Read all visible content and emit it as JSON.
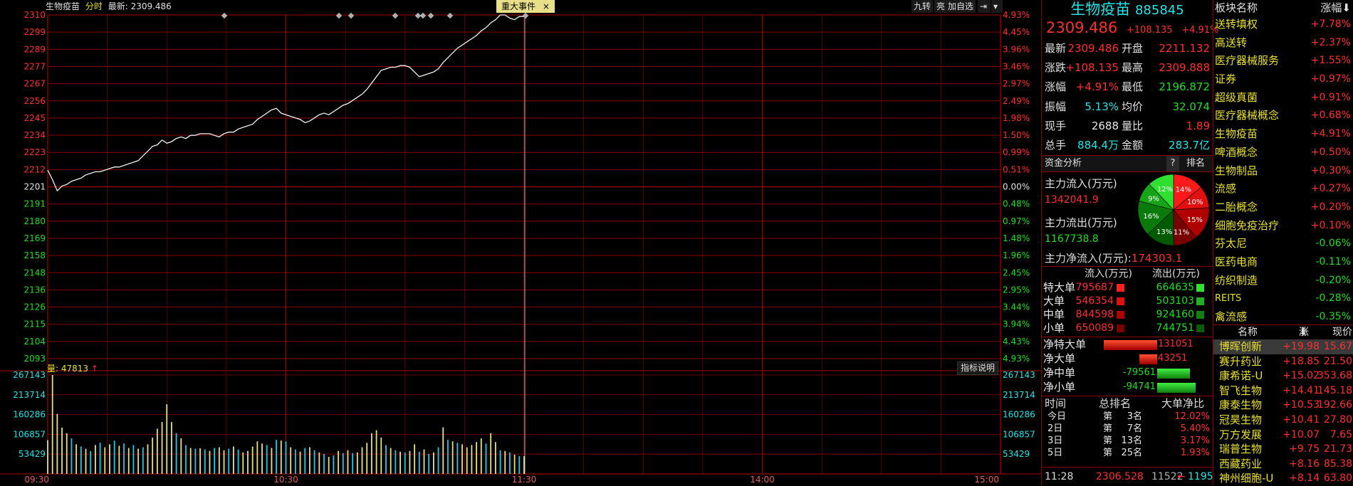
{
  "header": {
    "name": "生物疫苗",
    "mode": "分时",
    "latest_label": "最新:",
    "latest_value": "2309.486",
    "event_tab": "重大事件",
    "event_close": "×",
    "buttons": [
      "九转",
      "亮",
      "加自选"
    ]
  },
  "chart_data": {
    "type": "line",
    "y_ticks": [
      "2310",
      "2299",
      "2289",
      "2277",
      "2267",
      "2256",
      "2245",
      "2234",
      "2223",
      "2212",
      "2201",
      "2191",
      "2180",
      "2169",
      "2158",
      "2148",
      "2136",
      "2126",
      "2115",
      "2104",
      "2093"
    ],
    "pct_ticks": [
      "4.93%",
      "4.45%",
      "3.96%",
      "3.46%",
      "2.97%",
      "2.49%",
      "1.98%",
      "1.50%",
      "0.99%",
      "0.51%",
      "0.00%",
      "0.48%",
      "0.97%",
      "1.48%",
      "1.96%",
      "2.45%",
      "2.95%",
      "3.44%",
      "3.94%",
      "4.43%",
      "4.93%"
    ],
    "prev_close": 2201.351,
    "ylim": [
      2093,
      2310
    ],
    "time_ticks": [
      "09:30",
      "10:30",
      "11:30",
      "14:00",
      "15:00"
    ],
    "price_series": [
      2212,
      2206,
      2199,
      2202,
      2203,
      2205,
      2206,
      2207,
      2209,
      2210,
      2211,
      2211,
      2212,
      2213,
      2214,
      2214,
      2215,
      2216,
      2217,
      2218,
      2221,
      2224,
      2227,
      2228,
      2231,
      2229,
      2230,
      2232,
      2233,
      2232,
      2234,
      2234,
      2235,
      2235,
      2235,
      2234,
      2233,
      2235,
      2236,
      2236,
      2238,
      2239,
      2240,
      2241,
      2244,
      2246,
      2248,
      2250,
      2251,
      2248,
      2247,
      2246,
      2245,
      2244,
      2242,
      2243,
      2245,
      2247,
      2248,
      2247,
      2249,
      2251,
      2253,
      2254,
      2256,
      2258,
      2260,
      2263,
      2267,
      2271,
      2275,
      2276,
      2277,
      2277,
      2278,
      2278,
      2277,
      2274,
      2271,
      2272,
      2273,
      2274,
      2276,
      2280,
      2283,
      2286,
      2289,
      2291,
      2293,
      2295,
      2297,
      2300,
      2302,
      2305,
      2307,
      2310,
      2310,
      2308,
      2307,
      2309,
      2309
    ],
    "volume": {
      "label": "量:",
      "value": "47813",
      "y_ticks": [
        "267143",
        "213714",
        "160286",
        "106857",
        "53429"
      ],
      "ylim": [
        0,
        267143
      ],
      "bars": [
        91000,
        267143,
        162000,
        125000,
        110000,
        96000,
        80000,
        74000,
        68000,
        62000,
        78000,
        84000,
        72000,
        80000,
        90000,
        76000,
        82000,
        70000,
        78000,
        68000,
        72000,
        80000,
        98000,
        122000,
        140000,
        188000,
        140000,
        110000,
        96000,
        78000,
        70000,
        68000,
        69000,
        66000,
        62000,
        70000,
        72000,
        64000,
        68000,
        74000,
        66000,
        58000,
        62000,
        74000,
        88000,
        82000,
        78000,
        70000,
        92000,
        90000,
        88000,
        72000,
        66000,
        60000,
        70000,
        72000,
        64000,
        58000,
        54000,
        46000,
        50000,
        62000,
        56000,
        64000,
        56000,
        58000,
        72000,
        84000,
        110000,
        118000,
        98000,
        78000,
        70000,
        64000,
        60000,
        58000,
        62000,
        80000,
        60000,
        66000,
        54000,
        58000,
        72000,
        126000,
        92000,
        88000,
        84000,
        80000,
        72000,
        78000,
        86000,
        96000,
        82000,
        110000,
        86000,
        64000,
        62000,
        58000,
        52000,
        48000,
        47813
      ],
      "bar_colors_up": [
        true,
        true,
        true,
        true,
        true,
        false,
        true,
        false,
        true,
        false,
        true,
        false,
        true,
        true,
        false,
        true,
        false,
        true,
        false,
        true,
        false,
        true,
        true,
        true,
        true,
        true,
        true,
        false,
        true,
        false,
        true,
        false,
        true,
        false,
        true,
        false,
        true,
        true,
        false,
        true,
        false,
        true,
        true,
        true,
        true,
        true,
        false,
        true,
        false,
        true,
        false,
        true,
        false,
        true,
        false,
        true,
        false,
        true,
        false,
        true,
        false,
        true,
        false,
        true,
        false,
        true,
        true,
        true,
        true,
        true,
        true,
        false,
        true,
        false,
        true,
        false,
        true,
        true,
        false,
        true,
        false,
        true,
        false,
        true,
        false,
        true,
        false,
        true,
        true,
        true,
        true,
        true,
        false,
        true,
        true,
        false,
        true,
        false,
        true,
        false,
        true
      ]
    },
    "event_markers_count": 9
  },
  "indicator_button": "指标说明",
  "quote": {
    "title_name": "生物疫苗",
    "title_code": "885845",
    "price": "2309.486",
    "change": "+108.135",
    "change_pct": "+4.91%",
    "rows": [
      {
        "l1": "最新",
        "v1": "2309.486",
        "l2": "开盘",
        "v2": "2211.132",
        "c1": "red",
        "c2": "red"
      },
      {
        "l1": "涨跌",
        "v1": "+108.135",
        "l2": "最高",
        "v2": "2309.888",
        "c1": "red",
        "c2": "red"
      },
      {
        "l1": "涨幅",
        "v1": "+4.91%",
        "l2": "最低",
        "v2": "2196.872",
        "c1": "red",
        "c2": "green"
      },
      {
        "l1": "振幅",
        "v1": "5.13%",
        "l2": "均价",
        "v2": "32.074",
        "c1": "cyan",
        "c2": "green"
      },
      {
        "l1": "现手",
        "v1": "2688",
        "l2": "量比",
        "v2": "1.89",
        "c1": "white",
        "c2": "red"
      },
      {
        "l1": "总手",
        "v1": "884.4万",
        "l2": "金额",
        "v2": "283.7亿",
        "c1": "cyan",
        "c2": "cyan"
      }
    ]
  },
  "capital": {
    "header": "资金分析",
    "help": "?",
    "rank": "排名",
    "inflow_label": "主力流入(万元)",
    "inflow_value": "1342041.9",
    "outflow_label": "主力流出(万元)",
    "outflow_value": "1167738.8",
    "net_label": "主力净流入(万元):",
    "net_value": "174303.1",
    "pie": [
      {
        "label": "14%",
        "value": 14,
        "color": "#ff1a1a"
      },
      {
        "label": "10%",
        "value": 10,
        "color": "#e01010"
      },
      {
        "label": "15%",
        "value": 15,
        "color": "#b00000"
      },
      {
        "label": "11%",
        "value": 11,
        "color": "#7a0000"
      },
      {
        "label": "13%",
        "value": 13,
        "color": "#005a00"
      },
      {
        "label": "16%",
        "value": 16,
        "color": "#0a7a0a"
      },
      {
        "label": "9%",
        "value": 9,
        "color": "#16a516"
      },
      {
        "label": "12%",
        "value": 12,
        "color": "#30e030"
      }
    ],
    "flow_header_in": "流入(万元)",
    "flow_header_out": "流出(万元)",
    "flows": [
      {
        "name": "特大单",
        "in": "795687",
        "out": "664635"
      },
      {
        "name": "大单",
        "in": "546354",
        "out": "503103"
      },
      {
        "name": "中单",
        "in": "844598",
        "out": "924160"
      },
      {
        "name": "小单",
        "in": "650089",
        "out": "744751"
      }
    ],
    "nets": [
      {
        "name": "净特大单",
        "value": "131051",
        "amount": 131051
      },
      {
        "name": "净大单",
        "value": "43251",
        "amount": 43251
      },
      {
        "name": "净中单",
        "value": "-79561",
        "amount": -79561
      },
      {
        "name": "净小单",
        "value": "-94741",
        "amount": -94741
      }
    ],
    "rank_header": {
      "time": "时间",
      "rank": "总排名",
      "ratio": "大单净比"
    },
    "ranks": [
      {
        "time": "今日",
        "di": "第",
        "n": "3",
        "ming": "名",
        "ratio": "12.02%"
      },
      {
        "time": "2日",
        "di": "第",
        "n": "7",
        "ming": "名",
        "ratio": "5.40%"
      },
      {
        "time": "3日",
        "di": "第",
        "n": "13",
        "ming": "名",
        "ratio": "3.17%"
      },
      {
        "time": "5日",
        "di": "第",
        "n": "25",
        "ming": "名",
        "ratio": "1.93%"
      }
    ],
    "bottom": {
      "time": "11:28",
      "price": "2306.528",
      "vol": "11522",
      "arrow": "←",
      "count": "1195"
    }
  },
  "sectors": {
    "header_name": "板块名称",
    "header_pct": "涨幅",
    "sort_icon": "⬇",
    "rows": [
      {
        "name": "送转填权",
        "pct": "+7.78%"
      },
      {
        "name": "高送转",
        "pct": "+2.37%"
      },
      {
        "name": "医疗器械服务",
        "pct": "+1.55%"
      },
      {
        "name": "证券",
        "pct": "+0.97%"
      },
      {
        "name": "超级真菌",
        "pct": "+0.91%"
      },
      {
        "name": "医疗器械概念",
        "pct": "+0.68%"
      },
      {
        "name": "生物疫苗",
        "pct": "+4.91%"
      },
      {
        "name": "啤酒概念",
        "pct": "+0.50%"
      },
      {
        "name": "生物制品",
        "pct": "+0.30%"
      },
      {
        "name": "流感",
        "pct": "+0.27%"
      },
      {
        "name": "二胎概念",
        "pct": "+0.20%"
      },
      {
        "name": "细胞免疫治疗",
        "pct": "+0.10%"
      },
      {
        "name": "芬太尼",
        "pct": "-0.06%"
      },
      {
        "name": "医药电商",
        "pct": "-0.11%"
      },
      {
        "name": "纺织制造",
        "pct": "-0.20%"
      },
      {
        "name": "REITS",
        "pct": "-0.28%"
      },
      {
        "name": "禽流感",
        "pct": "-0.35%"
      }
    ]
  },
  "stocks": {
    "header_name": "名称",
    "header_pct": "涨幅%",
    "header_sort": "⬇",
    "header_price": "现价",
    "rows": [
      {
        "name": "博晖创新",
        "pct": "+19.98",
        "price": "15.67"
      },
      {
        "name": "赛升药业",
        "pct": "+18.85",
        "price": "21.50"
      },
      {
        "name": "康希诺-U",
        "pct": "+15.02",
        "price": "353.68"
      },
      {
        "name": "智飞生物",
        "pct": "+14.41",
        "price": "145.18"
      },
      {
        "name": "康泰生物",
        "pct": "+10.53",
        "price": "192.66"
      },
      {
        "name": "冠昊生物",
        "pct": "+10.41",
        "price": "27.80"
      },
      {
        "name": "万方发展",
        "pct": "+10.07",
        "price": "7.65"
      },
      {
        "name": "瑞普生物",
        "pct": "+9.75",
        "price": "21.73"
      },
      {
        "name": "西藏药业",
        "pct": "+8.16",
        "price": "85.38"
      },
      {
        "name": "神州细胞-U",
        "pct": "+8.14",
        "price": "63.80"
      }
    ]
  }
}
